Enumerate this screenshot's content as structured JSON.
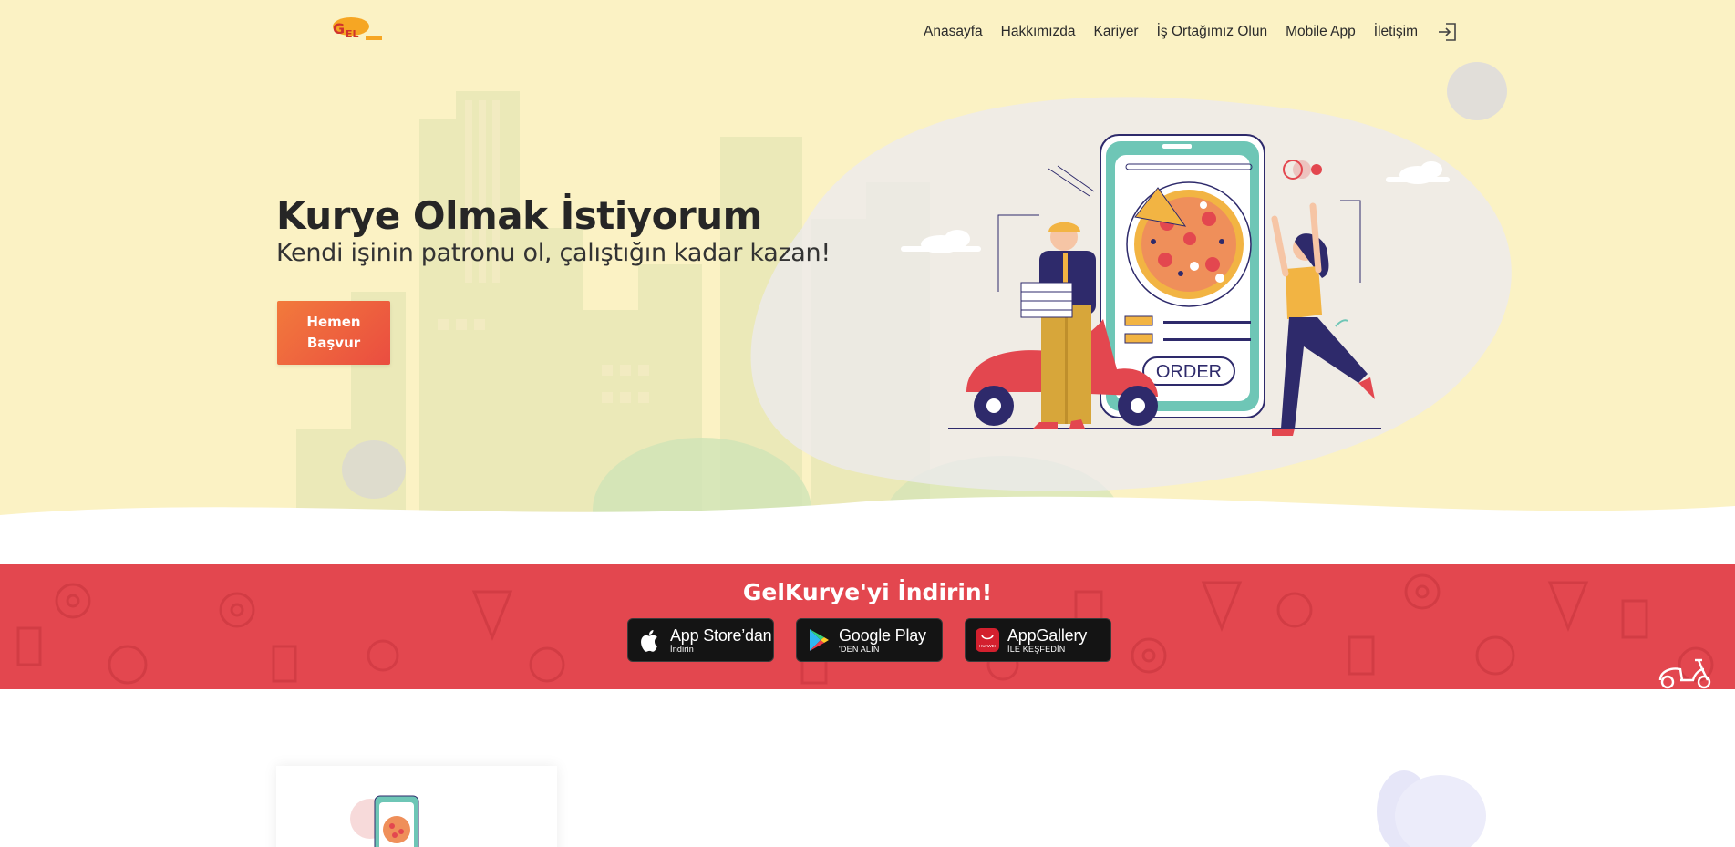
{
  "nav": {
    "items": [
      "Anasayfa",
      "Hakkımızda",
      "Kariyer",
      "İş Ortağımız Olun",
      "Mobile App",
      "İletişim"
    ],
    "login_icon": "login-icon"
  },
  "hero": {
    "title": "Kurye Olmak İstiyorum",
    "subtitle": "Kendi işinin patronu ol, çalıştığın kadar kazan!",
    "cta": "Hemen\nBaşvur",
    "phone_order_label": "ORDER"
  },
  "download": {
    "title": "GelKurye'yi İndirin!",
    "stores": [
      {
        "main": "App Store’dan",
        "small": "İndirin",
        "icon": "apple-icon"
      },
      {
        "main": "Google Play",
        "small": "'DEN ALIN",
        "icon": "google-play-icon"
      },
      {
        "main": "AppGallery",
        "small": "İLE KEŞFEDİN",
        "icon": "huawei-icon",
        "badge": "HUAWEI"
      }
    ]
  },
  "colors": {
    "hero_bg": "#fbf2c4",
    "band_bg": "#e3474f",
    "cta_start": "#f27a3c",
    "cta_end": "#ea4d40"
  }
}
